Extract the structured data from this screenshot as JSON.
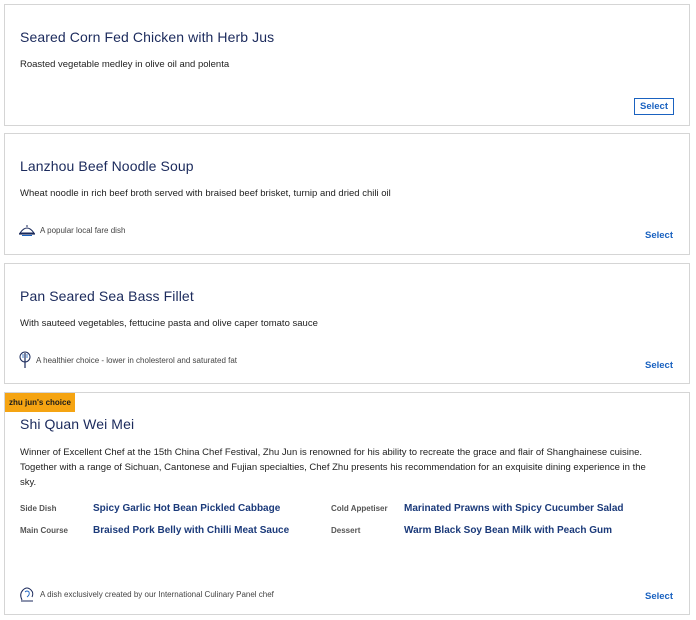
{
  "colors": {
    "title": "#1b2a5c",
    "accent": "#1a62c0",
    "badge": "#f5a412",
    "course_value": "#1b3a7a"
  },
  "dishes": [
    {
      "title": "Seared Corn Fed Chicken with Herb Jus",
      "description": "Roasted vegetable medley in olive oil and polenta",
      "select_label": "Select"
    },
    {
      "title": "Lanzhou Beef Noodle Soup",
      "description": "Wheat noodle in rich beef broth served with braised beef brisket, turnip and dried chili oil",
      "note": {
        "icon": "cloche-icon",
        "text": "A popular local fare dish"
      },
      "select_label": "Select"
    },
    {
      "title": "Pan Seared Sea Bass Fillet",
      "description": "With sauteed vegetables, fettucine pasta and olive caper tomato sauce",
      "note": {
        "icon": "healthy-choice-icon",
        "text": "A healthier choice - lower in cholesterol and saturated fat"
      },
      "select_label": "Select"
    },
    {
      "badge": "zhu jun's choice",
      "title": "Shi Quan Wei Mei",
      "description": "Winner of Excellent Chef at the 15th China Chef Festival, Zhu Jun is renowned for his ability to recreate the grace and flair of Shanghainese cuisine. Together with a range of Sichuan, Cantonese and Fujian specialties, Chef Zhu presents his recommendation for an exquisite dining experience in the sky.",
      "courses": [
        {
          "label": "Side Dish",
          "value": "Spicy Garlic Hot Bean Pickled Cabbage"
        },
        {
          "label": "Cold Appetiser",
          "value": "Marinated Prawns with Spicy Cucumber Salad"
        },
        {
          "label": "Main Course",
          "value": "Braised Pork Belly with Chilli Meat Sauce"
        },
        {
          "label": "Dessert",
          "value": "Warm Black Soy Bean Milk with Peach Gum"
        }
      ],
      "note": {
        "icon": "chef-hat-icon",
        "text": "A dish exclusively created by our International Culinary Panel chef"
      },
      "select_label": "Select"
    }
  ]
}
